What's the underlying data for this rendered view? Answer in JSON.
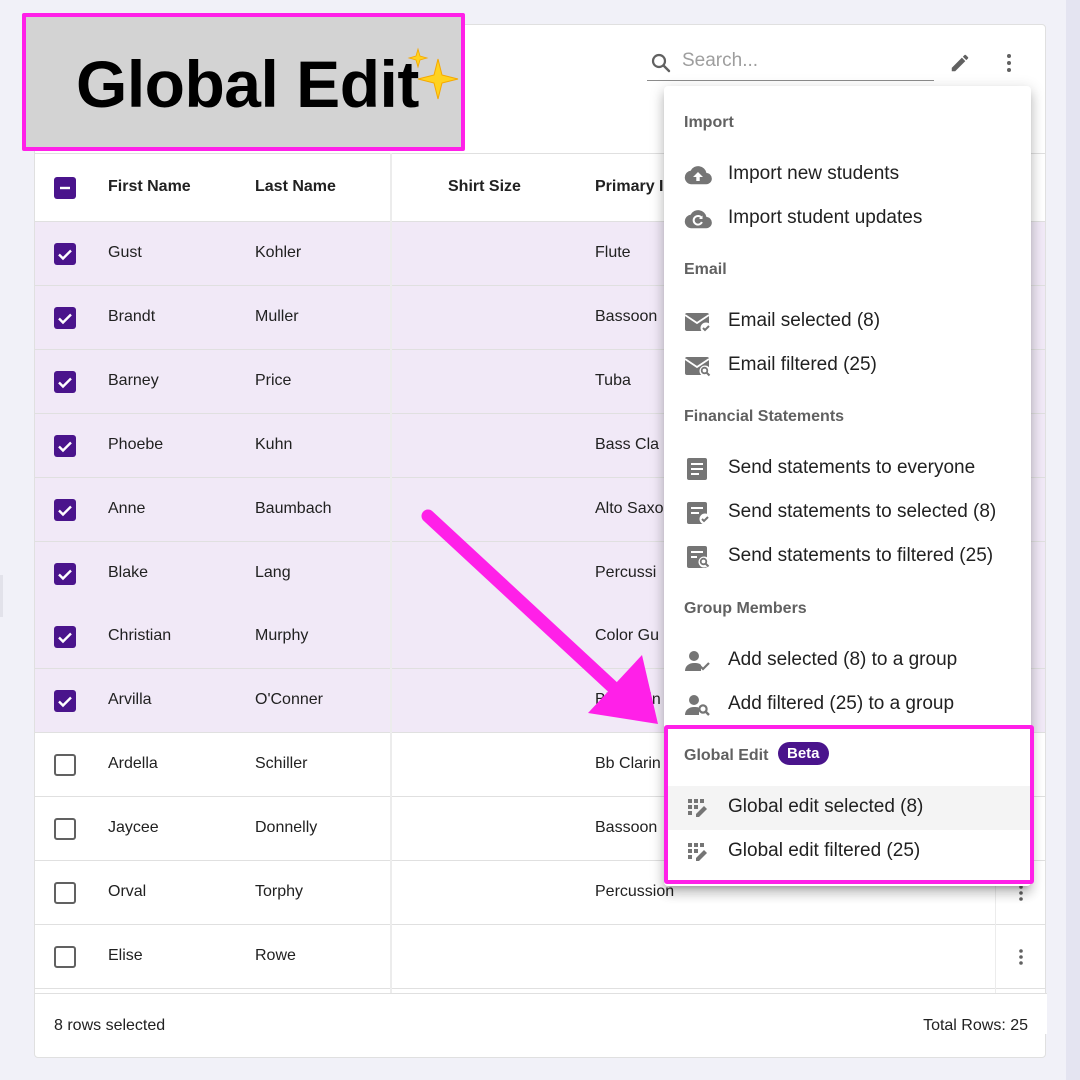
{
  "annotation": {
    "title": "Global Edit",
    "sparkle_icon": "sparkles-icon"
  },
  "toolbar": {
    "search_placeholder": "Search...",
    "edit_icon": "pencil-icon",
    "more_icon": "more-vertical-icon"
  },
  "table": {
    "columns": [
      "First Name",
      "Last Name",
      "Shirt Size",
      "Primary I"
    ],
    "rows": [
      {
        "first": "Gust",
        "last": "Kohler",
        "shirt": "",
        "primary": "Flute",
        "selected": true
      },
      {
        "first": "Brandt",
        "last": "Muller",
        "shirt": "",
        "primary": "Bassoon",
        "selected": true
      },
      {
        "first": "Barney",
        "last": "Price",
        "shirt": "",
        "primary": "Tuba",
        "selected": true
      },
      {
        "first": "Phoebe",
        "last": "Kuhn",
        "shirt": "",
        "primary": "Bass Cla",
        "selected": true
      },
      {
        "first": "Anne",
        "last": "Baumbach",
        "shirt": "",
        "primary": "Alto Saxo",
        "selected": true
      },
      {
        "first": "Blake",
        "last": "Lang",
        "shirt": "",
        "primary": "Percussi",
        "selected": true
      },
      {
        "first": "Christian",
        "last": "Murphy",
        "shirt": "",
        "primary": "Color Gu",
        "selected": true
      },
      {
        "first": "Arvilla",
        "last": "O'Conner",
        "shirt": "",
        "primary": "Bb Clarin",
        "selected": true
      },
      {
        "first": "Ardella",
        "last": "Schiller",
        "shirt": "",
        "primary": "Bb Clarin",
        "selected": false
      },
      {
        "first": "Jaycee",
        "last": "Donnelly",
        "shirt": "",
        "primary": "Bassoon",
        "selected": false
      },
      {
        "first": "Orval",
        "last": "Torphy",
        "shirt": "",
        "primary": "Percussion",
        "selected": false
      },
      {
        "first": "Elise",
        "last": "Rowe",
        "shirt": "",
        "primary": "",
        "selected": false
      }
    ]
  },
  "footer": {
    "selected_text": "8 rows selected",
    "total_text": "Total Rows: 25"
  },
  "menu": {
    "sections": {
      "import": "Import",
      "email": "Email",
      "financial": "Financial Statements",
      "group": "Group Members",
      "global_edit": "Global Edit"
    },
    "badge": "Beta",
    "items": {
      "import_new": {
        "label": "Import new students",
        "icon": "cloud-upload-icon"
      },
      "import_updates": {
        "label": "Import student updates",
        "icon": "cloud-sync-icon"
      },
      "email_selected": {
        "label": "Email selected (8)",
        "icon": "mail-check-icon"
      },
      "email_filtered": {
        "label": "Email filtered (25)",
        "icon": "mail-search-icon"
      },
      "stmt_everyone": {
        "label": "Send statements to everyone",
        "icon": "document-icon"
      },
      "stmt_selected": {
        "label": "Send statements to selected (8)",
        "icon": "document-check-icon"
      },
      "stmt_filtered": {
        "label": "Send statements to filtered (25)",
        "icon": "document-search-icon"
      },
      "group_selected": {
        "label": "Add selected (8) to a group",
        "icon": "person-check-icon"
      },
      "group_filtered": {
        "label": "Add filtered (25) to a group",
        "icon": "person-search-icon"
      },
      "ge_selected": {
        "label": "Global edit selected (8)",
        "icon": "grid-edit-icon"
      },
      "ge_filtered": {
        "label": "Global edit filtered (25)",
        "icon": "grid-edit-icon"
      }
    }
  },
  "colors": {
    "accent": "#4a148c",
    "selected_row": "#f1e9f7",
    "annotation": "#ff20e8"
  }
}
